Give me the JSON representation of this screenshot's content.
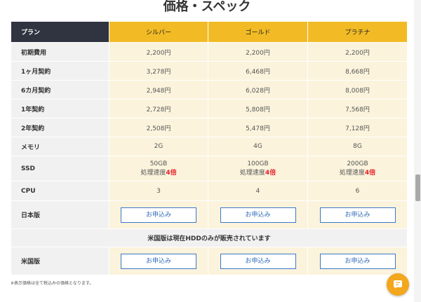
{
  "page": {
    "title": "価格・スペック",
    "footnote": "※表示価格は全て税込みの価格となります。"
  },
  "table": {
    "corner_label": "プラン",
    "plans": [
      "シルバー",
      "ゴールド",
      "プラチナ"
    ],
    "rows": {
      "initial": {
        "label": "初期費用",
        "values": [
          "2,200円",
          "2,200円",
          "2,200円"
        ]
      },
      "m1": {
        "label": "1ヶ月契約",
        "values": [
          "3,278円",
          "6,468円",
          "8,668円"
        ]
      },
      "m6": {
        "label": "6カ月契約",
        "values": [
          "2,948円",
          "6,028円",
          "8,008円"
        ]
      },
      "y1": {
        "label": "1年契約",
        "values": [
          "2,728円",
          "5,808円",
          "7,568円"
        ]
      },
      "y2": {
        "label": "2年契約",
        "values": [
          "2,508円",
          "5,478円",
          "7,128円"
        ]
      },
      "memory": {
        "label": "メモリ",
        "values": [
          "2G",
          "4G",
          "8G"
        ]
      },
      "ssd": {
        "label": "SSD",
        "capacity": [
          "50GB",
          "100GB",
          "200GB"
        ],
        "speed_prefix": "処理速度",
        "speed_value": "4倍"
      },
      "cpu": {
        "label": "CPU",
        "values": [
          "3",
          "4",
          "6"
        ]
      },
      "jp": {
        "label": "日本版",
        "button": "お申込み"
      },
      "banner": "米国版は現在HDDのみが販売されています",
      "us": {
        "label": "米国版",
        "button": "お申込み"
      }
    }
  },
  "colors": {
    "header_dark": "#2f3440",
    "header_gold": "#f2bb25",
    "cell_bg": "#fbf3dc",
    "highlight_red": "#e5212a",
    "button_blue": "#3b78c8",
    "chat_orange": "#f3a71c"
  },
  "icons": {
    "chat": "chat-bubble-icon"
  }
}
